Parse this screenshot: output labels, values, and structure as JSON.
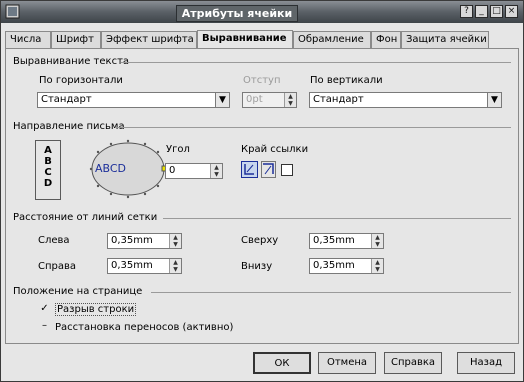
{
  "window": {
    "title": "Атрибуты ячейки"
  },
  "titlebar_buttons": {
    "help": "?",
    "minimize": "_",
    "maximize": "□",
    "close": "×"
  },
  "tabs": [
    {
      "label": "Числа"
    },
    {
      "label": "Шрифт"
    },
    {
      "label": "Эффект шрифта"
    },
    {
      "label": "Выравнивание"
    },
    {
      "label": "Обрамление"
    },
    {
      "label": "Фон"
    },
    {
      "label": "Защита ячейки"
    }
  ],
  "text_alignment": {
    "section": "Выравнивание текста",
    "horizontal_label": "По горизонтали",
    "horizontal_value": "Стандарт",
    "indent_label": "Отступ",
    "indent_value": "0pt",
    "vertical_label": "По вертикали",
    "vertical_value": "Стандарт"
  },
  "text_direction": {
    "section": "Направление письма",
    "vertical_text": "A B C D",
    "dial_text": "ABCD",
    "angle_label": "Угол",
    "angle_value": "0",
    "ref_edge_label": "Край ссылки"
  },
  "grid_spacing": {
    "section": "Расстояние от линий сетки",
    "left_label": "Слева",
    "left_value": "0,35mm",
    "right_label": "Справа",
    "right_value": "0,35mm",
    "top_label": "Сверху",
    "top_value": "0,35mm",
    "bottom_label": "Внизу",
    "bottom_value": "0,35mm"
  },
  "page_position": {
    "section": "Положение на странице",
    "wrap_label": "Разрыв строки",
    "wrap_checked": true,
    "hyphen_label": "Расстановка переносов (активно)",
    "hyphen_state": "–"
  },
  "buttons": {
    "ok": "ОК",
    "cancel": "Отмена",
    "help": "Справка",
    "back": "Назад"
  },
  "colors": {
    "dial_text": "#1c2f9a",
    "dial_marker": "#e8e000",
    "title_bg": "#5f6569"
  }
}
